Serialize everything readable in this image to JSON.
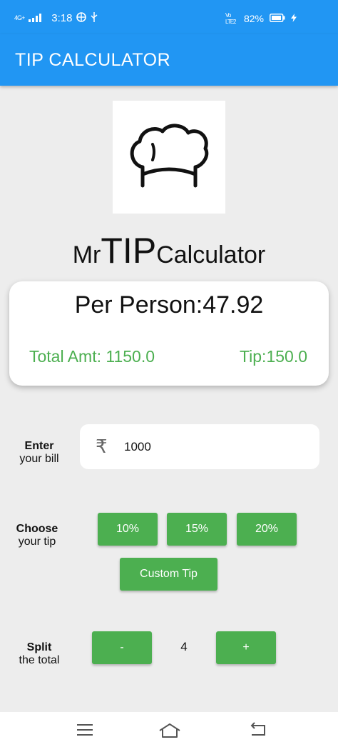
{
  "status": {
    "network": "4G+",
    "time": "3:18",
    "lte": "Vo LTE2",
    "battery": "82%"
  },
  "app_bar": {
    "title": "TIP CALCULATOR"
  },
  "brand": {
    "prefix": "Mr",
    "highlight": "TIP",
    "suffix": "Calculator"
  },
  "summary": {
    "per_person": "Per Person:47.92",
    "total_amt": "Total Amt: 1150.0",
    "tip": "Tip:150.0"
  },
  "bill": {
    "label_line1": "Enter",
    "label_line2": "your bill",
    "currency_symbol": "₹",
    "value": "1000"
  },
  "tip_choice": {
    "label_line1": "Choose",
    "label_line2": "your tip",
    "options": [
      "10%",
      "15%",
      "20%"
    ],
    "custom_label": "Custom Tip"
  },
  "split": {
    "label_line1": "Split",
    "label_line2": "the total",
    "decrement_label": "-",
    "increment_label": "+",
    "count": "4"
  },
  "colors": {
    "primary": "#2196f3",
    "accent": "#4caf50",
    "background": "#ededed"
  },
  "icons": [
    "chef-hat-icon",
    "menu-icon",
    "home-icon",
    "back-icon"
  ]
}
